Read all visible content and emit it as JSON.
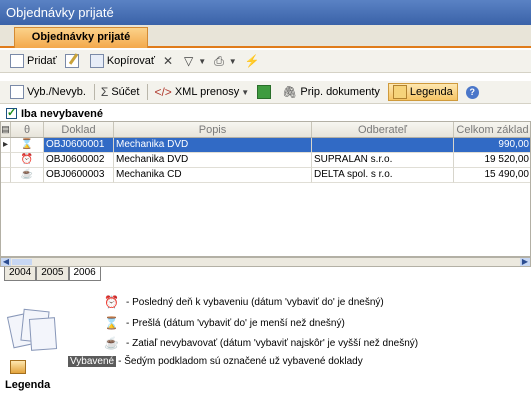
{
  "window": {
    "title": "Objednávky prijaté"
  },
  "tabs": [
    {
      "label": "Objednávky prijaté"
    }
  ],
  "toolbar1": {
    "add": "Pridať",
    "copy": "Kopírovať"
  },
  "toolbar2": {
    "select": "Vyb./Nevyb.",
    "sum": "Súčet",
    "xml": "XML prenosy",
    "attachments": "Prip. dokumenty",
    "legend": "Legenda"
  },
  "filter": {
    "label": "Iba nevybavené",
    "checked": true
  },
  "grid": {
    "headers": [
      "Doklad",
      "Popis",
      "Odberateľ",
      "Celkom základ"
    ],
    "rows": [
      {
        "doklad": "OBJ0600001",
        "popis": "Mechanika DVD",
        "odberatel": "",
        "celkom": "990,00",
        "status": "expired"
      },
      {
        "doklad": "OBJ0600002",
        "popis": "Mechanika DVD",
        "odberatel": "SUPRALAN s.r.o.",
        "celkom": "19 520,00",
        "status": "lastday"
      },
      {
        "doklad": "OBJ0600003",
        "popis": "Mechanika CD",
        "odberatel": "DELTA spol. s r.o.",
        "celkom": "15 490,00",
        "status": "notyet"
      }
    ]
  },
  "years": [
    "2004",
    "2005",
    "2006"
  ],
  "legend_panel": {
    "title": "Legenda",
    "items": [
      {
        "icon": "alarm-clock-icon",
        "text": "- Posledný deň k vybaveniu (dátum 'vybaviť do' je dnešný)"
      },
      {
        "icon": "expired-clock-icon",
        "text": "- Prešlá (dátum 'vybaviť do' je menší než dnešný)"
      },
      {
        "icon": "coffee-cup-icon",
        "text": "- Zatiaľ nevybavovať (dátum 'vybaviť najskôr' je vyšší než dnešný)"
      },
      {
        "badge": "Vybavené",
        "text": "- Šedým podkladom sú označené už vybavené doklady"
      }
    ]
  },
  "colors": {
    "selection": "#316ac5",
    "tab_accent": "#e07b1a",
    "title_bar": "#3a62a8"
  }
}
